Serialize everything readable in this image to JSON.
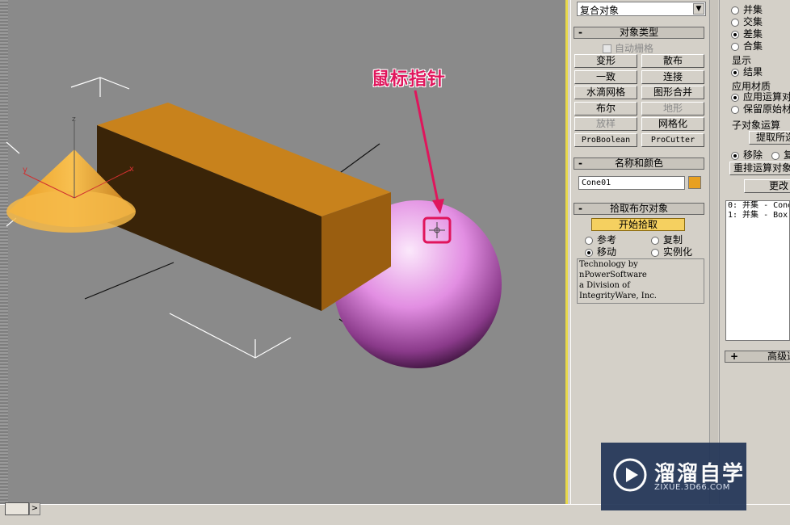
{
  "viewport": {
    "annotation": "鼠标指针",
    "colors": {
      "background": "#8a8a8a",
      "box": "#b8781a",
      "cone": "#f0a830",
      "sphere": "#e898e8",
      "annotation": "#e0155c",
      "active_border": "#e8d84a"
    }
  },
  "command_panel": {
    "category_dropdown": "复合对象",
    "object_type": {
      "title": "对象类型",
      "auto_grid": "自动栅格",
      "buttons": [
        "变形",
        "散布",
        "一致",
        "连接",
        "水滴网格",
        "图形合并",
        "布尔",
        "地形",
        "放样",
        "网格化",
        "ProBoolean",
        "ProCutter"
      ]
    },
    "name_color": {
      "title": "名称和颜色",
      "name_value": "Cone01",
      "color": "#e8a020"
    },
    "pick_boolean": {
      "title": "拾取布尔对象",
      "start_pick": "开始拾取",
      "options": {
        "reference": "参考",
        "copy": "复制",
        "move": "移动",
        "instance": "实例化"
      },
      "selected": "移动"
    },
    "credits": [
      "Technology by",
      "nPowerSoftware",
      "a Division of",
      "IntegrityWare, Inc."
    ]
  },
  "right_panel": {
    "operations": {
      "union": "并集",
      "intersection": "交集",
      "subtraction": "差集",
      "merge": "合集",
      "selected": "差集"
    },
    "display": {
      "title": "显示",
      "result": "结果"
    },
    "apply_material": {
      "title": "应用材质",
      "apply_op": "应用运算对",
      "keep_original": "保留原始材"
    },
    "sub_object": {
      "title": "子对象运算",
      "extract_button": "提取所选",
      "remove": "移除",
      "copy_partial": "复",
      "reorder_button": "重排运算对象",
      "change_button": "更改"
    },
    "op_list": [
      "0: 并集 - Cone",
      "1: 并集 - Box"
    ],
    "advanced_rollout": "高级选"
  },
  "watermark": {
    "title": "溜溜自学",
    "subtitle": "ZIXUE.3D66.COM"
  },
  "timeline": {
    "arrow": ">"
  }
}
